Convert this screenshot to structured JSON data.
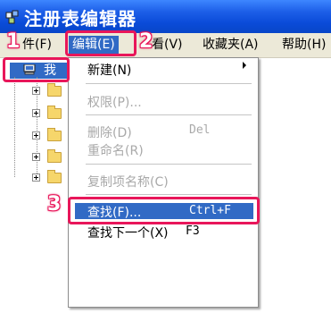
{
  "window": {
    "title": "注册表编辑器"
  },
  "menubar": {
    "file": "件(F)",
    "edit": "编辑(E)",
    "view": "看(V)",
    "favorites": "收藏夹(A)",
    "help": "帮助(H)"
  },
  "tree": {
    "root_label": "我",
    "folders": 5
  },
  "dropdown": {
    "items": {
      "new": "新建(N)",
      "permissions": "权限(P)...",
      "delete": "删除(D)",
      "delete_shortcut": "Del",
      "rename": "重命名(R)",
      "copy_key_name": "复制项名称(C)",
      "find": "查找(F)...",
      "find_shortcut": "Ctrl+F",
      "find_next": "查找下一个(X)",
      "find_next_shortcut": "F3"
    }
  },
  "annotations": {
    "step1": "1",
    "step2": "2",
    "step3": "3"
  },
  "colors": {
    "title_bar": "#0a4bd8",
    "menu_bar": "#ece9d8",
    "selection": "#316ac5",
    "annotation": "#e8165a"
  }
}
